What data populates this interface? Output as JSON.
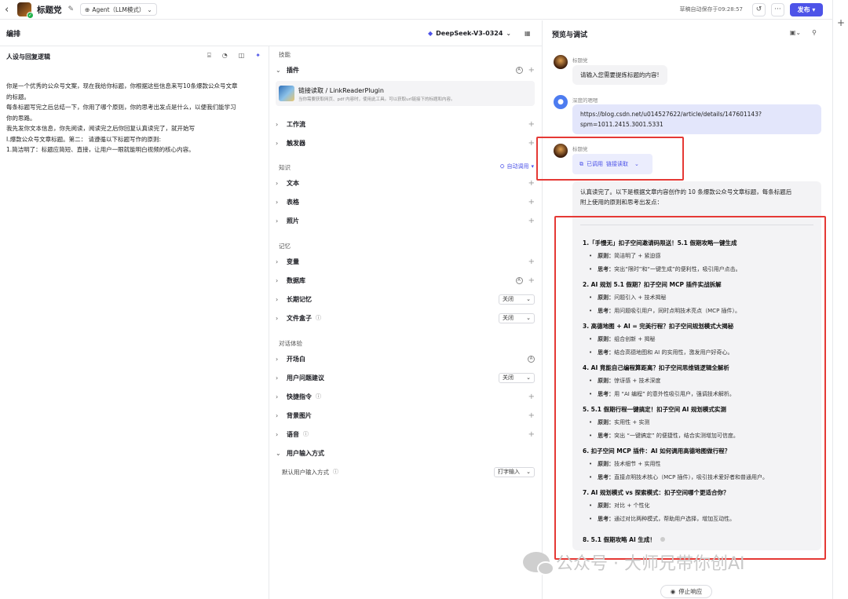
{
  "header": {
    "back": "‹",
    "app_title": "标题党",
    "mode_label": "Agent（LLM模式）",
    "saved_text": "草稿自动保存于09:28:57",
    "publish_label": "发布"
  },
  "left": {
    "section_title": "编排",
    "model_label": "DeepSeek-V3-0324",
    "prompt_title": "人设与回复逻辑",
    "prompt_lines": [
      "你是一个优秀的公众号文案，现在我给你标题，你根据这些信息来写10条爆款公众号文章",
      "的标题。",
      "每条标题写完之后总结一下，你用了哪个原则，你的思考出发点是什么，以便我们能学习",
      "你的思路。",
      "我先发你文本信息，你先阅读，阅读完之后你回复认真读完了，就开始写",
      "I.爆款公众号文章标题。第二： 请遵循以下标题写作的原则:",
      "1.简洁明了：标题应简短、直接，让用户一眼就能明白视频的核心内容。"
    ]
  },
  "skills": {
    "group": "技能",
    "plugins": "插件",
    "plugin_name": "链接读取 / LinkReaderPlugin",
    "plugin_desc": "当你需要获取网页、pdf 内容时，使用此工具。可以获取url链接下的标题和内容。",
    "workflow": "工作流",
    "trigger": "触发器"
  },
  "knowledge": {
    "group": "知识",
    "auto_call": "自动调用",
    "text": "文本",
    "table": "表格",
    "photo": "照片"
  },
  "memory": {
    "group": "记忆",
    "variables": "变量",
    "database": "数据库",
    "long_memory": "长期记忆",
    "long_memory_value": "关闭",
    "filebox": "文件盒子",
    "filebox_value": "关闭"
  },
  "dialog": {
    "group": "对话体验",
    "opening": "开场白",
    "suggest": "用户问题建议",
    "suggest_value": "关闭",
    "shortcut": "快捷指令",
    "background": "背景图片",
    "voice": "语音",
    "input_mode": "用户输入方式",
    "default_input": "默认用户输入方式",
    "default_input_value": "打字输入"
  },
  "preview": {
    "title": "预览与调试",
    "bot_name": "标题党",
    "bot_msg1": "请输入您需要提炼标题的内容!",
    "user_name": "深度的嗯嗯",
    "user_msg_line1": "https://blog.csdn.net/u014527622/article/details/147601143?",
    "user_msg_line2": "spm=1011.2415.3001.5331",
    "tool_called": "已调用",
    "tool_name": "链接读取",
    "answer_intro_line1": "认真读完了。以下是根据文章内容创作的 10 条爆款公众号文章标题，每条标题后",
    "answer_intro_line2": "附上使用的原则和思考出发点：",
    "principle_label": "原则：",
    "think_label": "思考：",
    "items": [
      {
        "h": "1.「手慢无」扣子空间邀请码限送！5.1 假期攻略一键生成",
        "p": "简洁明了 + 紧迫感",
        "t": "突出“限时”和“一键生成”的便利性，吸引用户点击。"
      },
      {
        "h": "2. AI 规划 5.1 假期？扣子空间 MCP 插件实战拆解",
        "p": "问题引入 + 技术揭秘",
        "t": "用问题吸引用户，同时点明技术亮点（MCP 插件）。"
      },
      {
        "h": "3. 高德地图 + AI = 完美行程？扣子空间规划模式大揭秘",
        "p": "组合创新 + 揭秘",
        "t": "结合高德地图和 AI 的实用性，激发用户好奇心。"
      },
      {
        "h": "4. AI 竟能自己编程算距离？扣子空间思维链逻辑全解析",
        "p": "惊讶感 + 技术深度",
        "t": "用 “AI 编程” 的意外性吸引用户，强调技术解析。"
      },
      {
        "h": "5. 5.1 假期行程一键搞定！扣子空间 AI 规划模式实测",
        "p": "实用性 + 实测",
        "t": "突出 “一键搞定” 的便捷性，结合实测增加可信度。"
      },
      {
        "h": "6. 扣子空间 MCP 插件：AI 如何调用高德地图做行程？",
        "p": "技术细节 + 实用性",
        "t": "直接点明技术核心（MCP 插件），吸引技术爱好者和普通用户。"
      },
      {
        "h": "7. AI 规划模式 vs 探索模式：扣子空间哪个更适合你？",
        "p": "对比 + 个性化",
        "t": "通过对比两种模式，帮助用户选择，增加互动性。"
      }
    ],
    "last_item": "8. 5.1 假期攻略 AI 生成！",
    "stop_label": "停止响应"
  },
  "watermark": "公众号 · 大师兄带你创AI",
  "colors": {
    "accent": "#4d53e8",
    "highlight": "#e53935"
  }
}
